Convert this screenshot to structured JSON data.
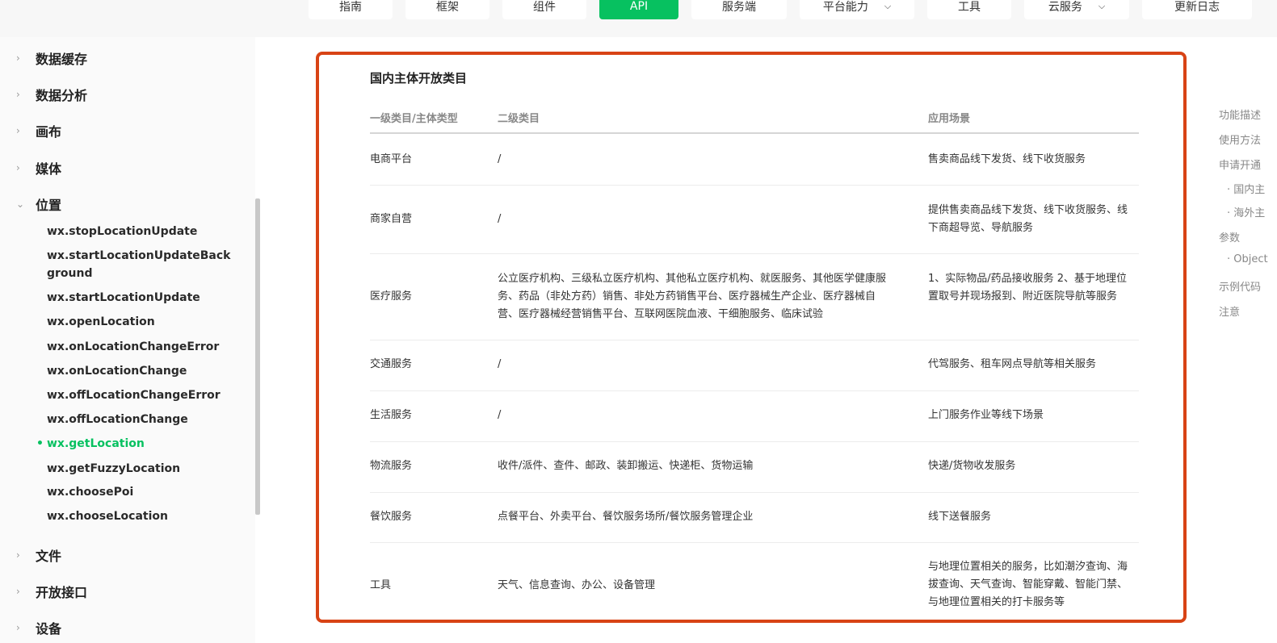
{
  "topnav": {
    "items": [
      {
        "label": "指南",
        "active": false,
        "has_dropdown": false
      },
      {
        "label": "框架",
        "active": false,
        "has_dropdown": false
      },
      {
        "label": "组件",
        "active": false,
        "has_dropdown": false
      },
      {
        "label": "API",
        "active": true,
        "has_dropdown": false
      },
      {
        "label": "服务端",
        "active": false,
        "has_dropdown": false
      },
      {
        "label": "平台能力",
        "active": false,
        "has_dropdown": true
      },
      {
        "label": "工具",
        "active": false,
        "has_dropdown": false
      },
      {
        "label": "云服务",
        "active": false,
        "has_dropdown": true
      },
      {
        "label": "更新日志",
        "active": false,
        "has_dropdown": false
      }
    ],
    "dropdown_icon": "chevron-down-icon"
  },
  "sidebar": {
    "groups_top": [
      {
        "label": "数据缓存",
        "expanded": false
      },
      {
        "label": "数据分析",
        "expanded": false
      },
      {
        "label": "画布",
        "expanded": false
      },
      {
        "label": "媒体",
        "expanded": false
      },
      {
        "label": "位置",
        "expanded": true
      }
    ],
    "location_items": [
      {
        "label": "wx.stopLocationUpdate",
        "active": false
      },
      {
        "label": "wx.startLocationUpdateBackground",
        "active": false
      },
      {
        "label": "wx.startLocationUpdate",
        "active": false
      },
      {
        "label": "wx.openLocation",
        "active": false
      },
      {
        "label": "wx.onLocationChangeError",
        "active": false
      },
      {
        "label": "wx.onLocationChange",
        "active": false
      },
      {
        "label": "wx.offLocationChangeError",
        "active": false
      },
      {
        "label": "wx.offLocationChange",
        "active": false
      },
      {
        "label": "wx.getLocation",
        "active": true
      },
      {
        "label": "wx.getFuzzyLocation",
        "active": false
      },
      {
        "label": "wx.choosePoi",
        "active": false
      },
      {
        "label": "wx.chooseLocation",
        "active": false
      }
    ],
    "groups_bottom": [
      {
        "label": "文件",
        "expanded": false
      },
      {
        "label": "开放接口",
        "expanded": false
      },
      {
        "label": "设备",
        "expanded": false
      }
    ],
    "active_dot": "•"
  },
  "main": {
    "section_title": "国内主体开放类目",
    "highlight_color": "#d84315",
    "table": {
      "headers": [
        "一级类目/主体类型",
        "二级类目",
        "应用场景"
      ],
      "rows": [
        {
          "primary": "电商平台",
          "secondary": "/",
          "scenario": "售卖商品线下发货、线下收货服务"
        },
        {
          "primary": "商家自营",
          "secondary": "/",
          "scenario": "提供售卖商品线下发货、线下收货服务、线下商超导览、导航服务"
        },
        {
          "primary": "医疗服务",
          "secondary": "公立医疗机构、三级私立医疗机构、其他私立医疗机构、就医服务、其他医学健康服务、药品（非处方药）销售、非处方药销售平台、医疗器械生产企业、医疗器械自营、医疗器械经营销售平台、互联网医院血液、干细胞服务、临床试验",
          "scenario": "1、实际物品/药品接收服务 2、基于地理位置取号并现场报到、附近医院导航等服务"
        },
        {
          "primary": "交通服务",
          "secondary": "/",
          "scenario": "代驾服务、租车网点导航等相关服务"
        },
        {
          "primary": "生活服务",
          "secondary": "/",
          "scenario": "上门服务作业等线下场景"
        },
        {
          "primary": "物流服务",
          "secondary": "收件/派件、查件、邮政、装卸搬运、快递柜、货物运输",
          "scenario": "快递/货物收发服务"
        },
        {
          "primary": "餐饮服务",
          "secondary": "点餐平台、外卖平台、餐饮服务场所/餐饮服务管理企业",
          "scenario": "线下送餐服务"
        },
        {
          "primary": "工具",
          "secondary": "天气、信息查询、办公、设备管理",
          "scenario": "与地理位置相关的服务，比如潮汐查询、海拔查询、天气查询、智能穿戴、智能门禁、与地理位置相关的打卡服务等"
        }
      ]
    }
  },
  "toc": {
    "items": [
      {
        "label": "功能描述"
      },
      {
        "label": "使用方法"
      },
      {
        "label": "申请开通"
      },
      {
        "label": "· 国内主"
      },
      {
        "label": "· 海外主"
      },
      {
        "label": "参数"
      },
      {
        "label": "· Object"
      },
      {
        "label": "示例代码"
      },
      {
        "label": "注意"
      }
    ]
  },
  "colors": {
    "accent": "#07c160",
    "highlight_border": "#d84315"
  }
}
